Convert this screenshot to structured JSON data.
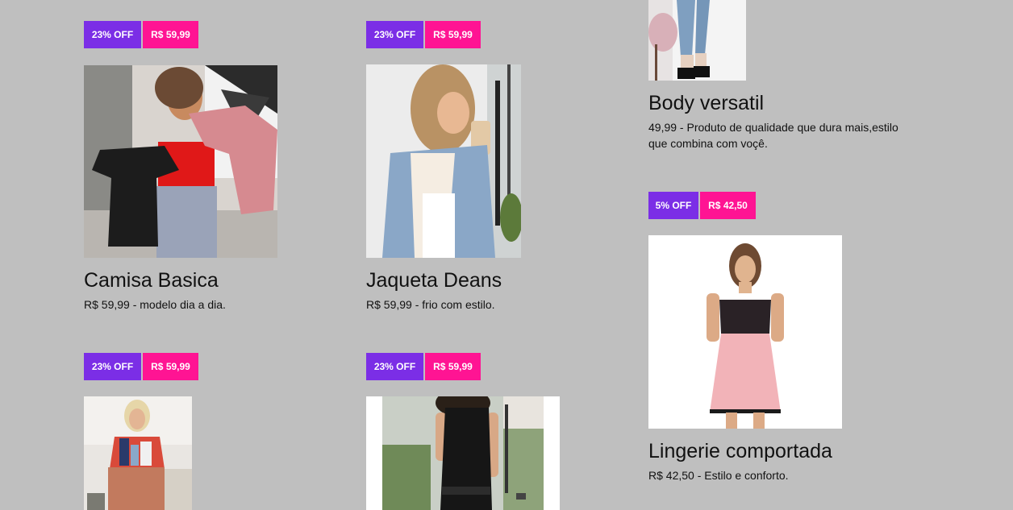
{
  "products": [
    {
      "discount": "23% OFF",
      "price_badge": "R$ 59,99",
      "title": "Camisa Basica",
      "description": "R$ 59,99 - modelo dia a dia."
    },
    {
      "discount": "23% OFF",
      "price_badge": "R$ 59,99",
      "title": "Jaqueta Deans",
      "description": "R$ 59,99 - frio com estilo."
    },
    {
      "title": "Body versatil",
      "description": "49,99 - Produto de qualidade que dura mais,estilo que combina com voçê."
    },
    {
      "discount": "5% OFF",
      "price_badge": "R$ 42,50",
      "title": "Lingerie comportada",
      "description": "R$ 42,50 - Estilo e conforto."
    },
    {
      "discount": "23% OFF",
      "price_badge": "R$ 59,99"
    },
    {
      "discount": "23% OFF",
      "price_badge": "R$ 59,99"
    }
  ],
  "colors": {
    "background": "#bfbfbf",
    "discount_badge": "#7b2ee6",
    "price_badge": "#ff1493"
  }
}
